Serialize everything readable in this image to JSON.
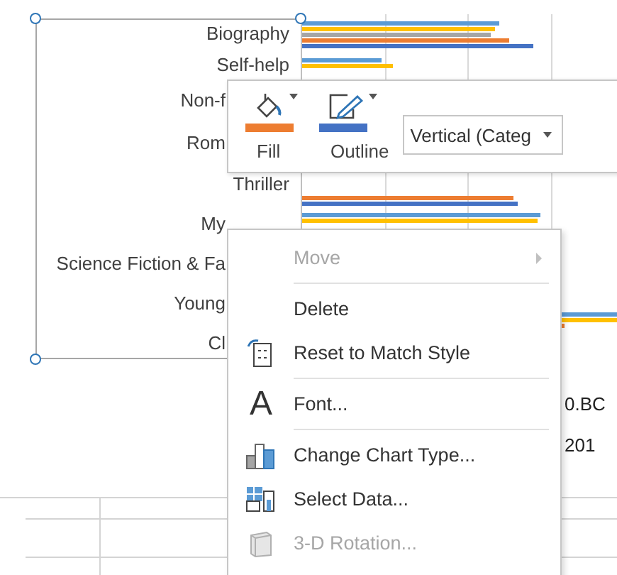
{
  "chart": {
    "categories": [
      {
        "label": "Biography",
        "kind": "full"
      },
      {
        "label": "Self-help",
        "kind": "full"
      },
      {
        "label": "Non-f",
        "kind": "cut"
      },
      {
        "label": "Rom",
        "kind": "cut"
      },
      {
        "label": "Thriller",
        "kind": "full"
      },
      {
        "label": "My",
        "kind": "cut"
      },
      {
        "label": "Science Fiction & Fa",
        "kind": "cut"
      },
      {
        "label": "Young",
        "kind": "cut"
      },
      {
        "label": "Cl",
        "kind": "cut"
      }
    ]
  },
  "sheet": {
    "cells": [
      "0.BC",
      "201"
    ]
  },
  "mini_toolbar": {
    "fill": {
      "label": "Fill",
      "color": "#ed7d31"
    },
    "outline": {
      "label": "Outline",
      "color": "#4472c4"
    },
    "element_picker": {
      "value": "Vertical (Categ"
    }
  },
  "context_menu": {
    "groups": [
      [
        {
          "label": "Move",
          "kind": "plain",
          "disabled": true,
          "submenu": true
        }
      ],
      [
        {
          "label": "Delete",
          "kind": "plain",
          "disabled": false,
          "submenu": false
        },
        {
          "label": "Reset to Match Style",
          "kind": "reset",
          "disabled": false,
          "submenu": false
        }
      ],
      [
        {
          "label": "Font...",
          "kind": "font",
          "icon_text": "A",
          "disabled": false,
          "submenu": false
        }
      ],
      [
        {
          "label": "Change Chart Type...",
          "kind": "chart",
          "disabled": false,
          "submenu": false
        },
        {
          "label": "Select Data...",
          "kind": "data",
          "disabled": false,
          "submenu": false
        },
        {
          "label": "3-D Rotation...",
          "kind": "rotation",
          "disabled": true,
          "submenu": false
        }
      ]
    ]
  }
}
